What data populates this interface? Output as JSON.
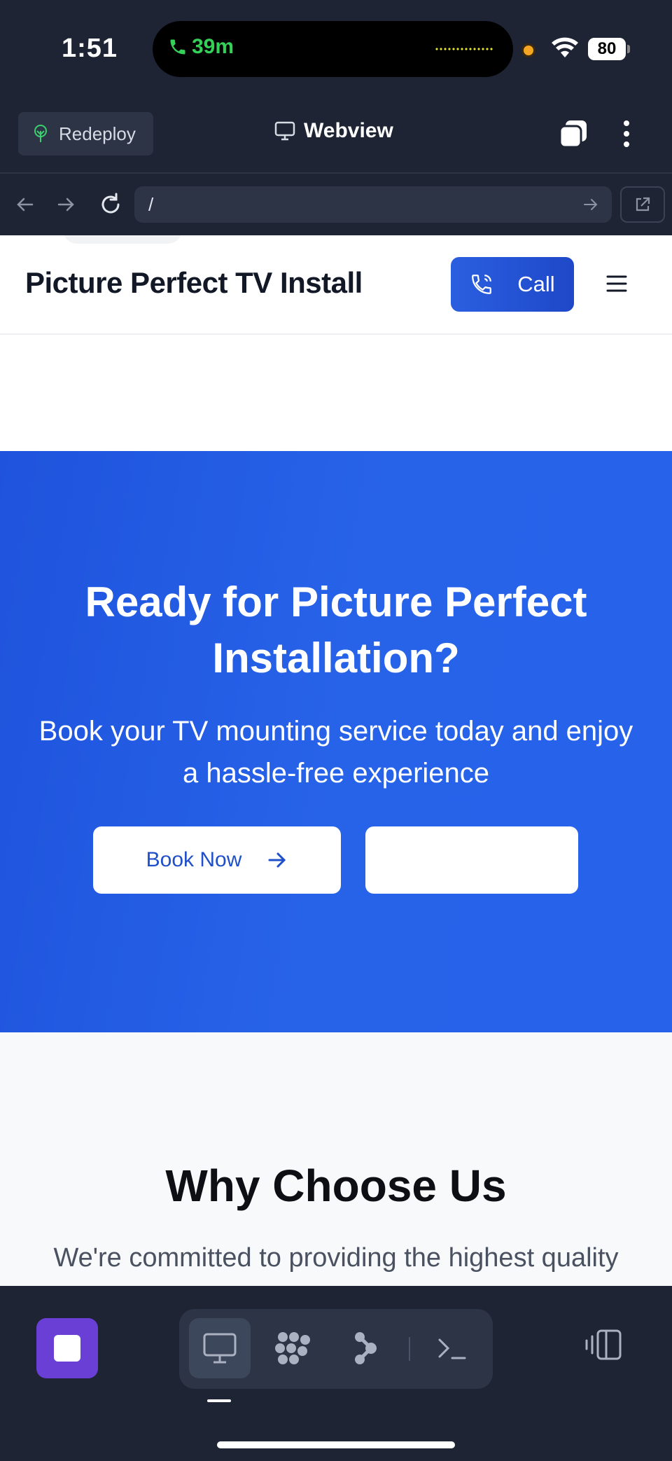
{
  "status_bar": {
    "time": "1:51",
    "call_duration": "39m",
    "battery": "80"
  },
  "toolbar": {
    "redeploy_label": "Redeploy",
    "webview_label": "Webview"
  },
  "url_bar": {
    "value": "/"
  },
  "site": {
    "brand": "Picture Perfect TV Install",
    "call_label": "Call"
  },
  "hero": {
    "title": "Ready for Picture Perfect Installation?",
    "subtitle": "Book your TV mounting service today and enjoy a hassle-free experience",
    "book_label": "Book Now",
    "secondary_label": ""
  },
  "why": {
    "title": "Why Choose Us",
    "subtitle": "We're committed to providing the highest quality"
  },
  "colors": {
    "chrome_bg": "#1e2433",
    "hero_blue": "#2763e9",
    "call_button": "#2a5fe0",
    "stop_button": "#6a3fd6"
  }
}
